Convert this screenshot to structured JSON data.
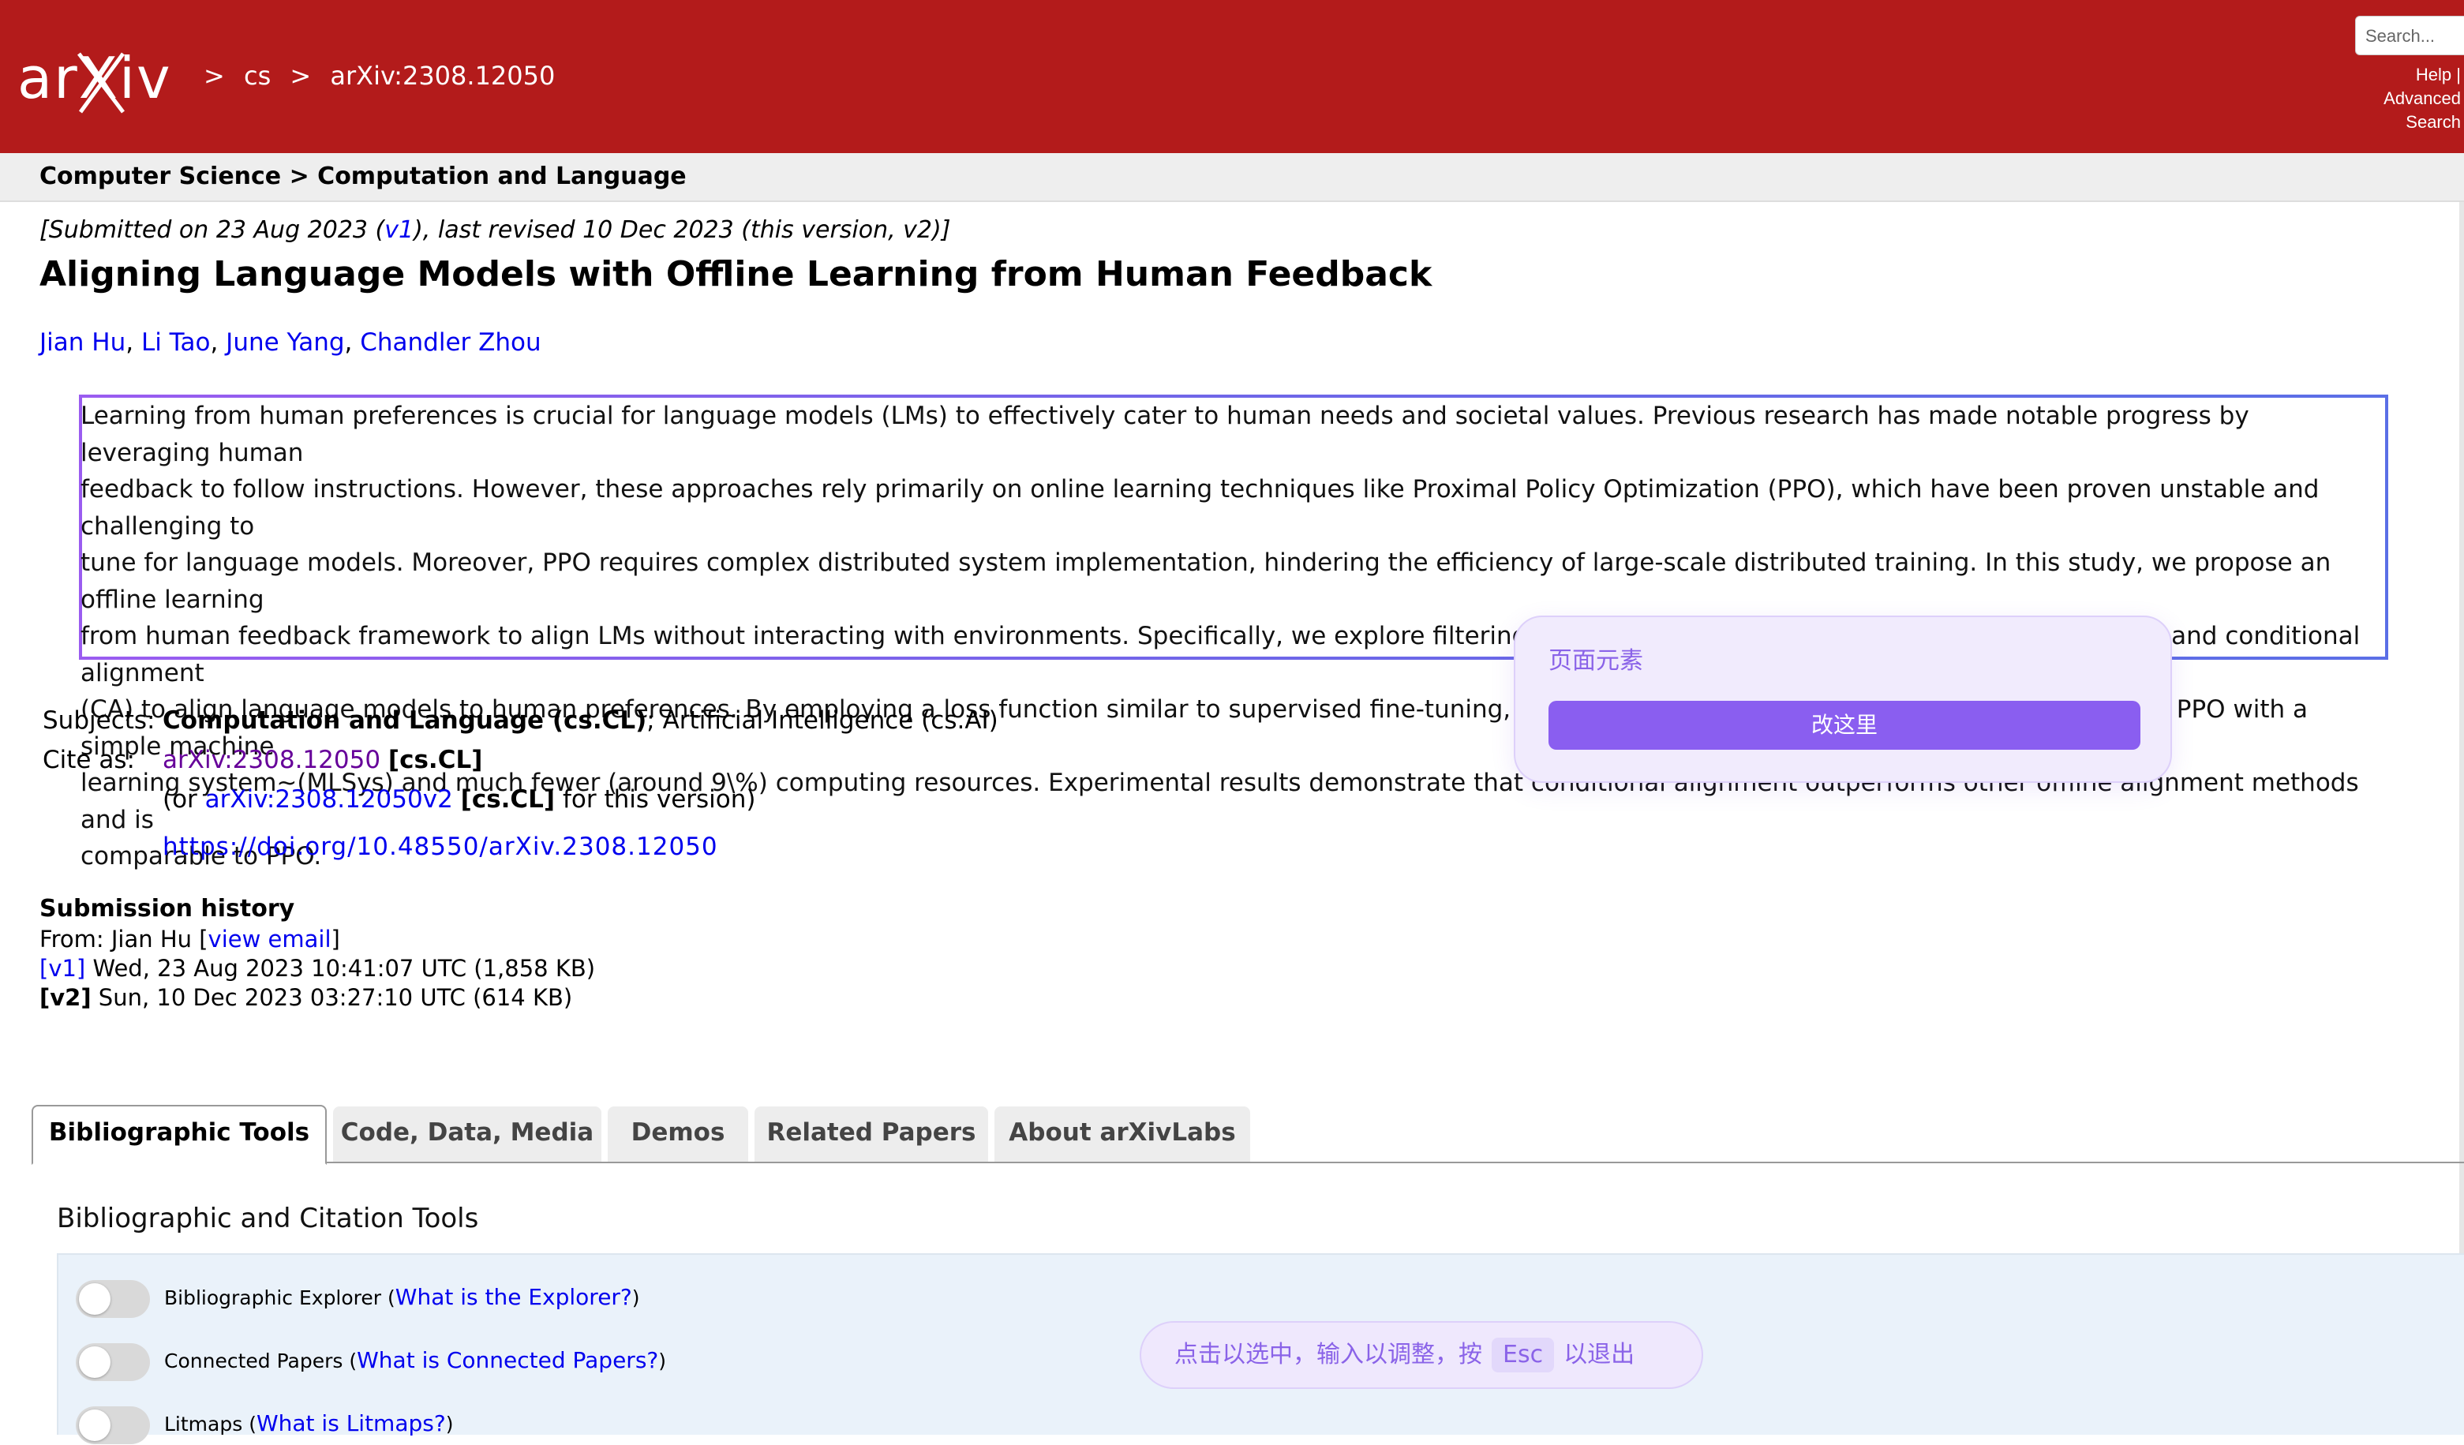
{
  "header": {
    "logo_text": "arXiv",
    "breadcrumbs": [
      ">",
      "cs",
      ">",
      "arXiv:2308.12050"
    ],
    "search_placeholder": "Search...",
    "help_label": "Help |",
    "advanced_label": "Advanced",
    "search_label": "Search"
  },
  "subheader": {
    "path": "Computer Science > Computation and Language"
  },
  "paper": {
    "dateline_1": "[Submitted on 23 Aug 2023 (",
    "dateline_v1": "v1",
    "dateline_2": "), last revised 10 Dec 2023 (this version, v2)]",
    "title": "Aligning Language Models with Offline Learning from Human Feedback",
    "authors": [
      "Jian Hu",
      "Li Tao",
      "June Yang",
      "Chandler Zhou"
    ],
    "abstract_lines": [
      "Learning from human preferences is crucial for language models (LMs) to effectively cater to human needs and societal values. Previous research has made notable progress by leveraging human",
      "feedback to follow instructions. However, these approaches rely primarily on online learning techniques like Proximal Policy Optimization (PPO), which have been proven unstable and challenging to",
      "tune for language models. Moreover, PPO requires complex distributed system implementation, hindering the efficiency of large-scale distributed training. In this study, we propose an offline learning",
      "from human feedback framework to align LMs without interacting with environments. Specifically, we explore filtering alignment (FA), reward-weighted regression (RWR), and conditional alignment",
      "(CA) to align language models to human preferences. By employing a loss function similar to supervised fine-tuning, our methods ensure more stable model training than PPO with a simple machine",
      "learning system~(MLSys) and much fewer (around 9\\%) computing resources. Experimental results demonstrate that conditional alignment outperforms other offline alignment methods and is",
      "comparable to PPO."
    ]
  },
  "meta": {
    "subjects_label": "Subjects:",
    "subjects_primary": "Computation and Language (cs.CL)",
    "subjects_rest": "; Artificial Intelligence (cs.AI)",
    "cite_label": "Cite as:",
    "cite_id": "arXiv:2308.12050",
    "cite_cat": "[cs.CL]",
    "cite_or": "(or ",
    "cite_v2": "arXiv:2308.12050v2",
    "cite_v2_cat": "[cs.CL]",
    "cite_v2_tail": " for this version)",
    "doi": "https://doi.org/10.48550/arXiv.2308.12050"
  },
  "history": {
    "title": "Submission history",
    "from_prefix": "From: Jian Hu [",
    "view_email": "view email",
    "from_suffix": "]",
    "v1_tag": "[v1]",
    "v1_text": " Wed, 23 Aug 2023 10:41:07 UTC (1,858 KB)",
    "v2_tag": "[v2]",
    "v2_text": " Sun, 10 Dec 2023 03:27:10 UTC (614 KB)"
  },
  "tabs": [
    "Bibliographic Tools",
    "Code, Data, Media",
    "Demos",
    "Related Papers",
    "About arXivLabs"
  ],
  "tools": {
    "section_title": "Bibliographic and Citation Tools",
    "rows": [
      {
        "name": "Bibliographic Explorer",
        "open": " (",
        "link": "What is the Explorer?",
        "close": ")"
      },
      {
        "name": "Connected Papers",
        "open": " (",
        "link": "What is Connected Papers?",
        "close": ")"
      },
      {
        "name": "Litmaps",
        "open": " (",
        "link": "What is Litmaps?",
        "close": ")"
      }
    ]
  },
  "overlay": {
    "popup_label": "页面元素",
    "popup_button": "改这里",
    "hint_prefix": "点击以选中，输入以调整，按",
    "hint_key": "Esc",
    "hint_suffix": "以退出"
  },
  "colors": {
    "brand": "#b31b1b",
    "link": "#0000ee",
    "visited": "#660099",
    "accent": "#8a5ef0"
  }
}
